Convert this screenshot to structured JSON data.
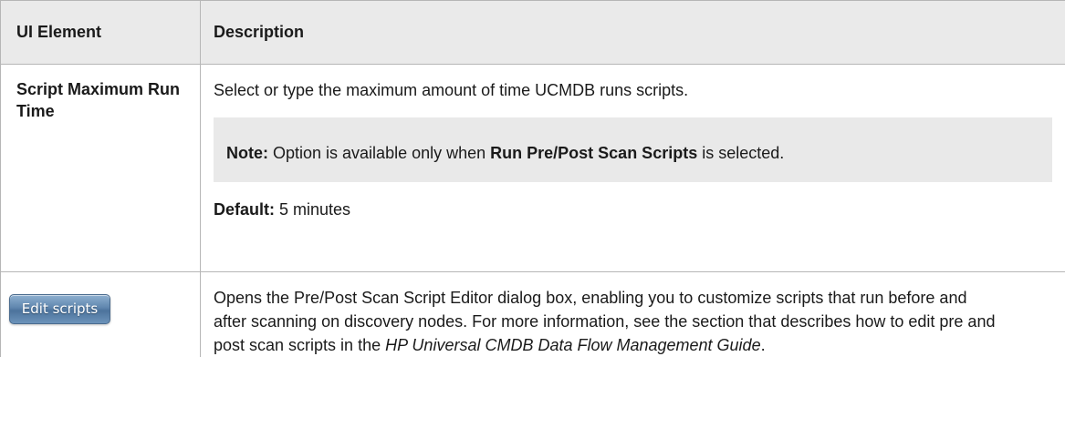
{
  "table": {
    "headers": {
      "element": "UI Element",
      "description": "Description"
    },
    "rows": [
      {
        "element": "Script Maximum Run Time",
        "description": "Select or type the maximum amount of time UCMDB runs scripts.",
        "note": {
          "label": "Note:",
          "text_before": " Option is available only when ",
          "bold_term": "Run Pre/Post Scan Scripts",
          "text_after": " is selected."
        },
        "default": {
          "label": "Default:",
          "value": " 5 minutes"
        }
      },
      {
        "button_label": "Edit scripts",
        "description_before": "Opens the Pre/Post Scan Script Editor dialog box, enabling you to customize scripts that run before and after scanning on discovery nodes. For more information, see the section that describes how to edit pre and post scan scripts in the ",
        "guide_title": "HP Universal CMDB Data Flow Management Guide",
        "description_after": "."
      }
    ]
  },
  "colors": {
    "header_bg": "#eaeaea",
    "note_bg": "#e9e9e9",
    "border": "#b6b6b6",
    "button_blue": "#5f86ae"
  }
}
